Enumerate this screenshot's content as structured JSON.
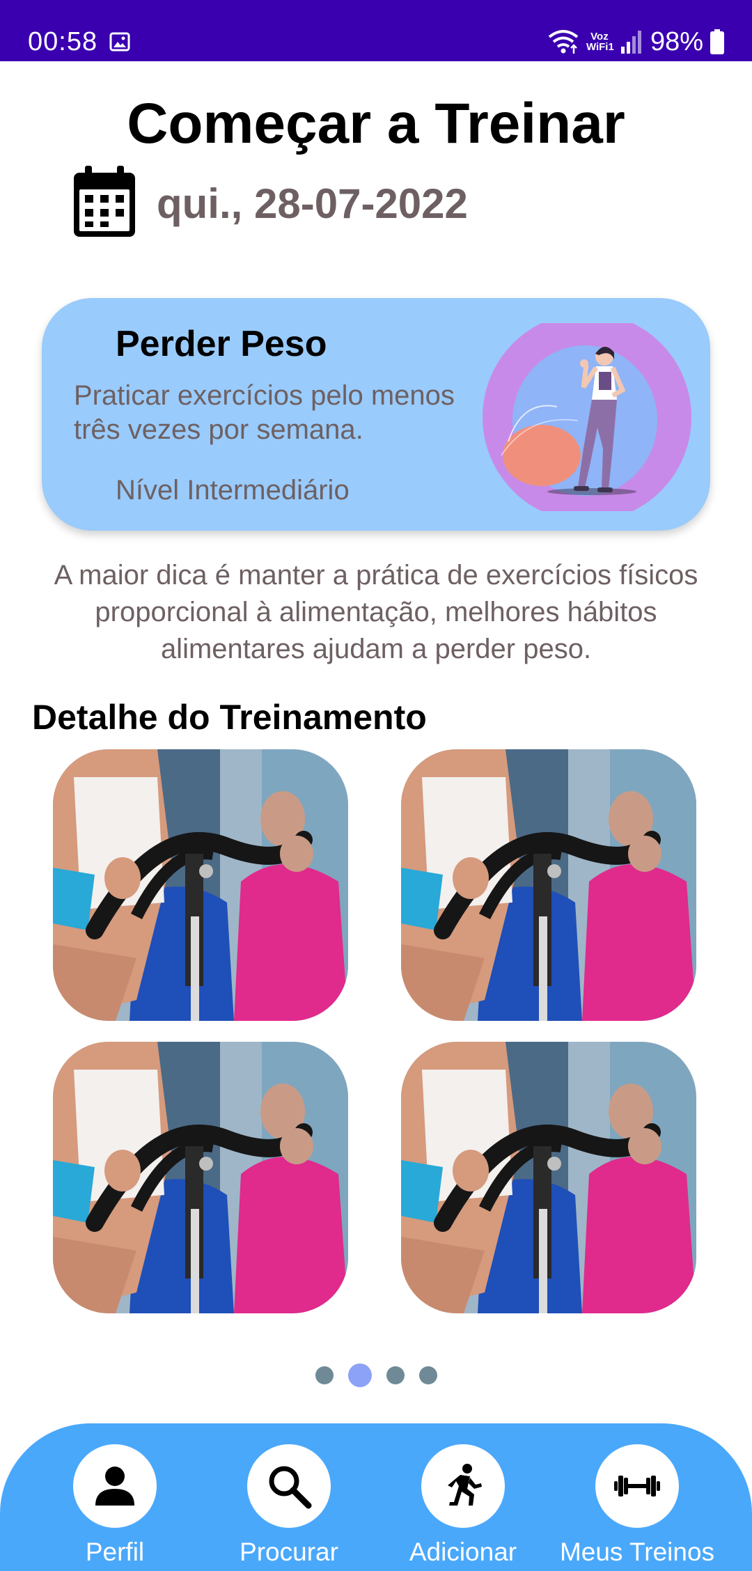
{
  "status_bar": {
    "time": "00:58",
    "network_label": "Voz\nWiFi1",
    "battery_percent": "98%",
    "icons": [
      "gallery-icon",
      "wifi-icon",
      "volte-icon",
      "signal-icon",
      "battery-icon"
    ],
    "background_color": "#3a00b0"
  },
  "header": {
    "title": "Começar a Treinar",
    "date": "qui., 28-07-2022",
    "date_icon": "calendar-icon"
  },
  "goal_card": {
    "title": "Perder Peso",
    "description": "Praticar exercícios pelo menos três vezes por semana.",
    "level": "Nível Intermediário",
    "illustration": "woman-with-exercise-ball-illustration",
    "background_color": "#99cbfc"
  },
  "tip": {
    "text": "A maior dica é manter a prática de exercícios físicos proporcional à alimentação, melhores hábitos alimentares ajudam a perder peso."
  },
  "training_detail": {
    "title": "Detalhe do Treinamento",
    "tiles": [
      {
        "image": "spinning-class-photo"
      },
      {
        "image": "spinning-class-photo"
      },
      {
        "image": "spinning-class-photo"
      },
      {
        "image": "spinning-class-photo"
      }
    ]
  },
  "pager": {
    "pages": 4,
    "active_index": 1
  },
  "bottom_nav": {
    "background_color": "#4aa8fb",
    "items": [
      {
        "label": "Perfil",
        "icon": "person-icon"
      },
      {
        "label": "Procurar",
        "icon": "search-icon"
      },
      {
        "label": "Adicionar",
        "icon": "running-person-icon"
      },
      {
        "label": "Meus Treinos",
        "icon": "dumbbell-icon"
      }
    ]
  }
}
